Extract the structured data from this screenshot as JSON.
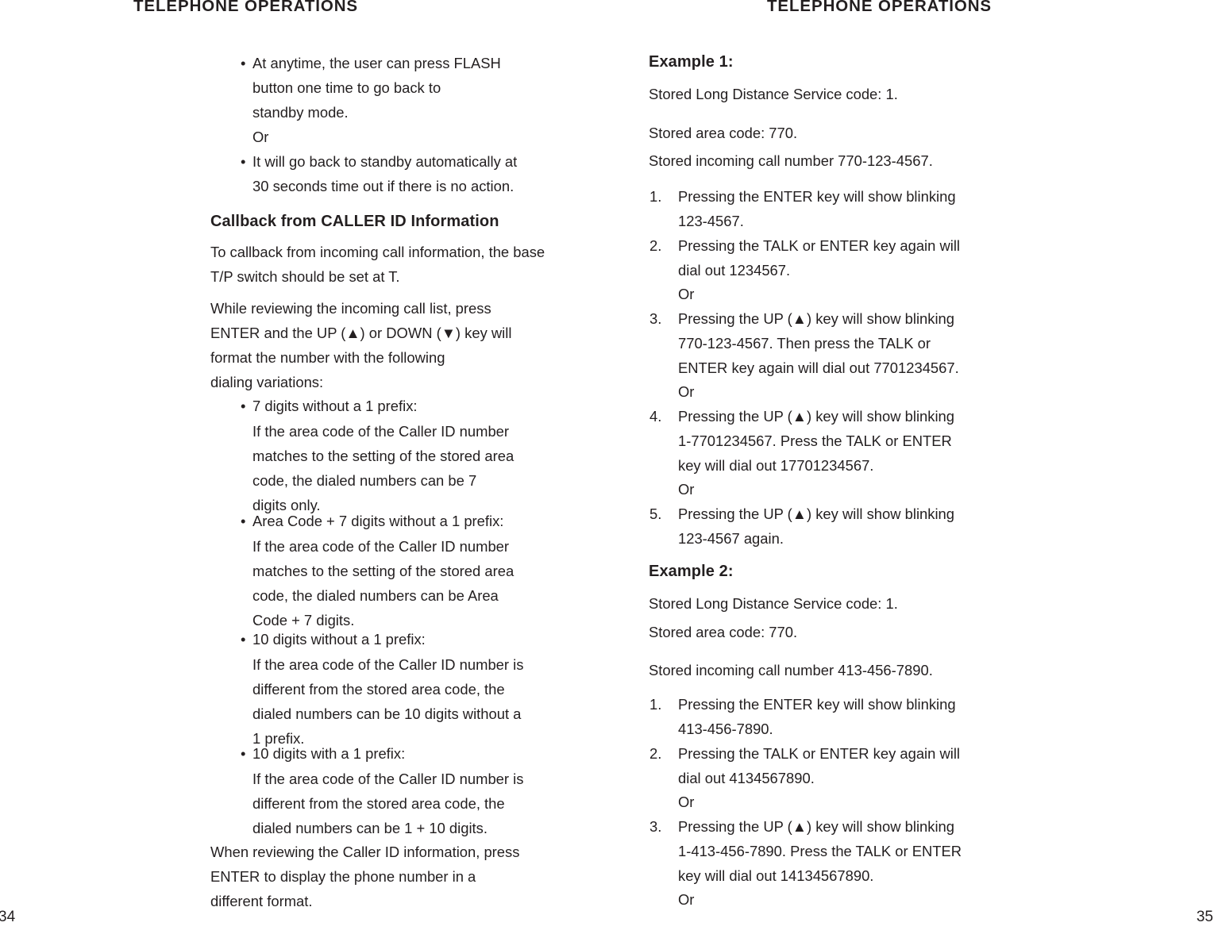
{
  "document": {
    "running_head_left": "TELEPHONE OPERATIONS",
    "running_head_right": "TELEPHONE OPERATIONS",
    "folio_left": "34",
    "folio_right": "35",
    "text_color": "#231f20",
    "background": "#ffffff"
  },
  "left_page": {
    "top_bullets": [
      {
        "marker": "•",
        "text": "At anytime, the user can press FLASH\nbutton one time to go back to\nstandby mode."
      },
      {
        "marker": "•",
        "text": "It will go back to standby automatically at\n30 seconds time out if there is no action."
      }
    ],
    "or_after_first_bullet": "Or",
    "heading": "Callback from CALLER ID Information",
    "para_1": "To callback from incoming call information, the base\nT/P switch should be set at T.",
    "para_2": "While reviewing the incoming call list, press\nENTER and the UP (▲) or DOWN (▼) key will\nformat the number with the following\ndialing variations:",
    "variations": [
      {
        "marker": "•",
        "title": "7 digits without a 1 prefix:",
        "body": "If the area code of the Caller ID number\nmatches to the setting of the stored area\ncode, the dialed numbers can be 7\ndigits only."
      },
      {
        "marker": "•",
        "title": "Area Code + 7 digits without a 1 prefix:",
        "body": "If the area code of the Caller ID number\nmatches to the setting of the stored area\ncode, the dialed numbers can be Area\nCode + 7 digits."
      },
      {
        "marker": "•",
        "title": "10 digits without a 1 prefix:",
        "body": "If the area code of the Caller ID number is\ndifferent from the stored area code, the\ndialed numbers can be 10 digits without a\n1 prefix."
      },
      {
        "marker": "•",
        "title": "10 digits with a 1 prefix:",
        "body": "If the area code of the Caller ID number is\ndifferent from the stored area code, the\ndialed numbers can be 1 + 10 digits."
      }
    ],
    "closing_para": "When reviewing the Caller ID information, press\nENTER to display the phone number in a\ndifferent format."
  },
  "right_page": {
    "example_1": {
      "heading": "Example 1:",
      "line_1": "Stored Long Distance Service code: 1.",
      "line_2": "Stored area code: 770.",
      "line_3": "Stored incoming call number 770-123-4567.",
      "steps": [
        {
          "marker": "1.",
          "text": "Pressing the ENTER key will show blinking\n123-4567."
        },
        {
          "marker": "2.",
          "text": "Pressing the TALK or ENTER key again will\ndial out 1234567."
        },
        {
          "marker": "3.",
          "text": "Pressing the UP (▲) key will show blinking\n770-123-4567. Then press the TALK or\nENTER key again will dial out 7701234567."
        },
        {
          "marker": "4.",
          "text": "Pressing the UP (▲) key will show blinking\n1-7701234567. Press the TALK or ENTER\nkey will dial out 17701234567."
        },
        {
          "marker": "5.",
          "text": "Pressing the UP (▲) key will show blinking\n123-4567 again."
        }
      ],
      "or_1": "Or",
      "or_2": "Or",
      "or_3": "Or"
    },
    "example_2": {
      "heading": "Example 2:",
      "line_1": "Stored Long Distance Service code: 1.",
      "line_2": "Stored area code: 770.",
      "line_3": "Stored incoming call number 413-456-7890.",
      "steps": [
        {
          "marker": "1.",
          "text": "Pressing the ENTER key will show blinking\n413-456-7890."
        },
        {
          "marker": "2.",
          "text": "Pressing the TALK or ENTER key again will\ndial out 4134567890."
        },
        {
          "marker": "3.",
          "text": "Pressing the UP (▲) key will show blinking\n1-413-456-7890. Press the TALK or ENTER\nkey will dial out 14134567890."
        }
      ],
      "or_1": "Or",
      "or_2": "Or"
    }
  }
}
